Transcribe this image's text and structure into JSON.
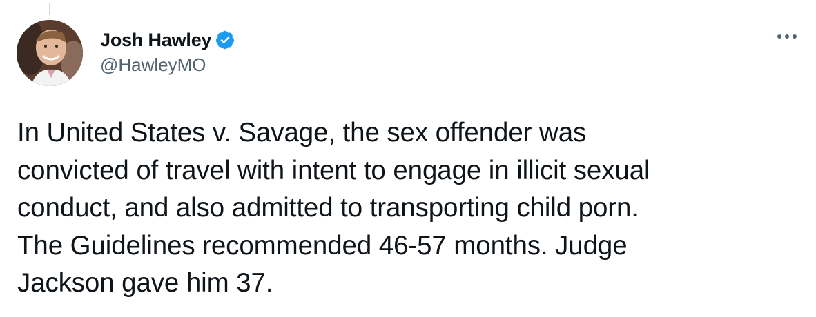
{
  "author": {
    "display_name": "Josh Hawley",
    "handle": "@HawleyMO",
    "verified": true,
    "avatar_icon": "profile-photo"
  },
  "tweet": {
    "text": "In United States v. Savage, the sex offender was\nconvicted of travel with intent to engage in illicit sexual\nconduct, and also admitted to transporting child porn.\nThe Guidelines recommended 46-57 months. Judge\nJackson gave him 37."
  },
  "icons": {
    "verified": "verified-badge-icon",
    "more": "more-options-icon"
  },
  "colors": {
    "text_primary": "#0f1419",
    "text_secondary": "#536471",
    "verified_blue": "#1d9bf0"
  }
}
